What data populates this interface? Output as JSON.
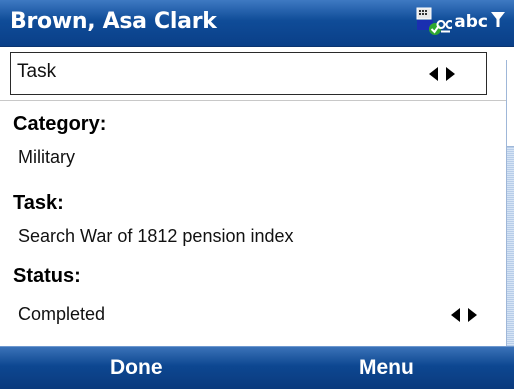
{
  "header": {
    "title": "Brown, Asa Clark",
    "input_mode": "abc",
    "icons": [
      "calendar-sync-icon",
      "voicemail-icon",
      "signal-filter-icon"
    ]
  },
  "selector": {
    "value": "Task"
  },
  "fields": {
    "category_label": "Category:",
    "category_value": "Military",
    "task_label": "Task:",
    "task_value": "Search War of 1812 pension index",
    "status_label": "Status:",
    "status_value": "Completed"
  },
  "softkeys": {
    "left": "Done",
    "right": "Menu"
  },
  "colors": {
    "bar_blue": "#0f4c98",
    "scroll_track": "#c7d9f0"
  }
}
